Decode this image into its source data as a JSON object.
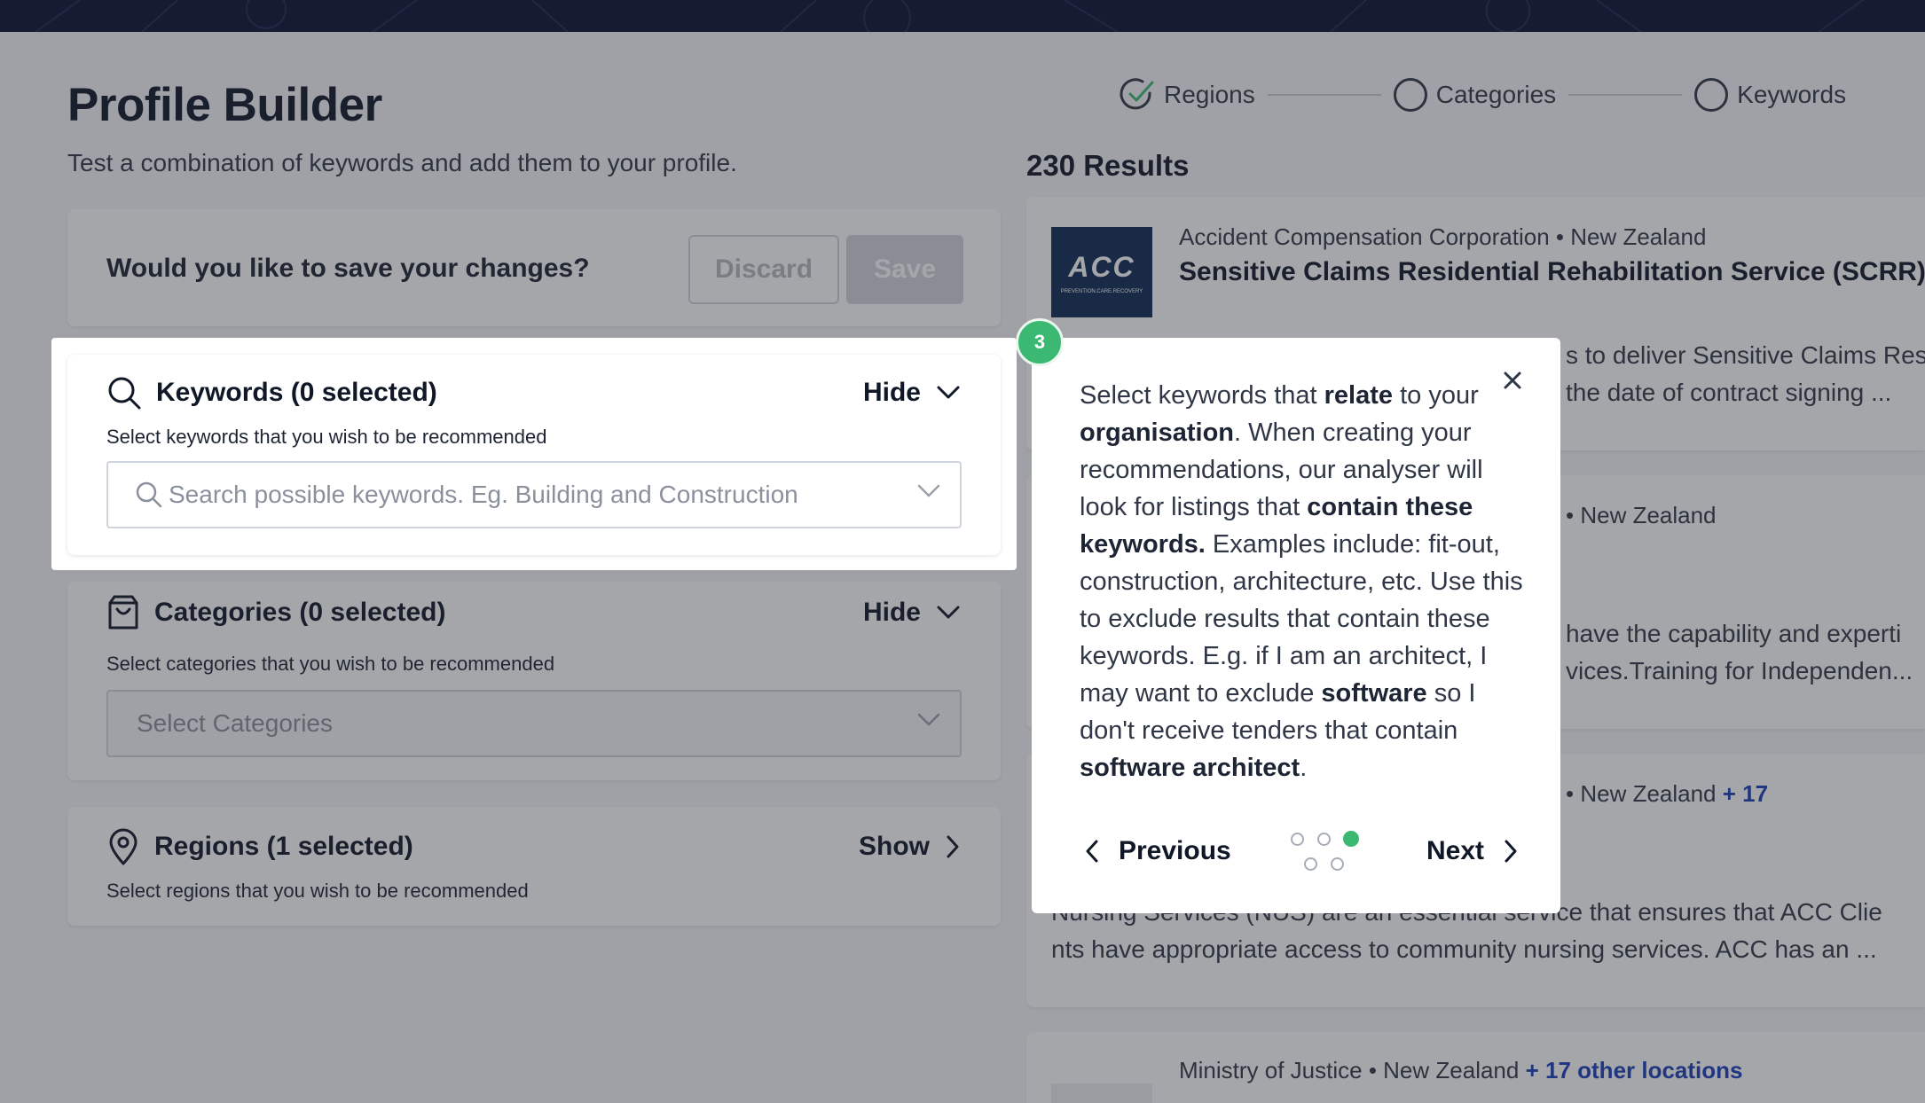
{
  "page": {
    "title": "Profile Builder",
    "subtitle": "Test a combination of keywords and add them to your profile."
  },
  "stepper": {
    "steps": [
      {
        "label": "Regions",
        "status": "complete"
      },
      {
        "label": "Categories",
        "status": "incomplete"
      },
      {
        "label": "Keywords",
        "status": "incomplete"
      }
    ]
  },
  "save_prompt": {
    "question": "Would you like to save your changes?",
    "discard_label": "Discard",
    "save_label": "Save"
  },
  "keywords": {
    "title": "Keywords (0 selected)",
    "toggle_label": "Hide",
    "description": "Select keywords that you wish to be recommended",
    "search_placeholder": "Search possible keywords. Eg. Building and Construction"
  },
  "categories": {
    "title": "Categories (0 selected)",
    "toggle_label": "Hide",
    "description": "Select categories that you wish to be recommended",
    "select_placeholder": "Select Categories"
  },
  "regions": {
    "title": "Regions (1 selected)",
    "toggle_label": "Show",
    "description": "Select regions that you wish to be recommended"
  },
  "results": {
    "heading": "230 Results",
    "items": [
      {
        "meta": "Accident Compensation Corporation • New Zealand",
        "title": "Sensitive Claims Residential Rehabilitation Service (SCRR)",
        "body_line1": "s to deliver Sensitive Claims Res",
        "body_line2": " the date of contract signing ...",
        "logo_text": "ACC",
        "logo_sub": "PREVENTION.CARE.RECOVERY"
      },
      {
        "meta": "• New Zealand",
        "body_line1": "have the capability and experti",
        "body_line2": "vices.Training for Independen..."
      },
      {
        "meta": "• New Zealand",
        "more_locations": "+ 17",
        "body_line1": "Nursing Services (NUS) are an essential service that ensures that ACC Clie",
        "body_line2": "nts have appropriate access to community nursing services. ACC has an ..."
      },
      {
        "meta": "Ministry of Justice • New Zealand",
        "more_locations": "+ 17 other locations"
      }
    ]
  },
  "tour": {
    "step_number": "3",
    "text_parts": {
      "p1": "Select keywords that ",
      "b1": "relate",
      "p2": " to your ",
      "b2": "organisation",
      "p3": ". When creating your recommendations, our analyser will look for listings that ",
      "b3": "contain these keywords.",
      "p4": " Examples include: fit-out, construction, architecture, etc. Use this to exclude results that contain these keywords. E.g. if I am an architect, I may want to exclude ",
      "b4": "software",
      "p5": " so I don't receive tenders that contain ",
      "b5": "software architect",
      "p6": "."
    },
    "previous_label": "Previous",
    "next_label": "Next",
    "total_steps": 5,
    "current_step_index": 2
  },
  "colors": {
    "accent_green": "#3bb872",
    "link_blue": "#1d3fb8",
    "navy": "#0b1130"
  }
}
